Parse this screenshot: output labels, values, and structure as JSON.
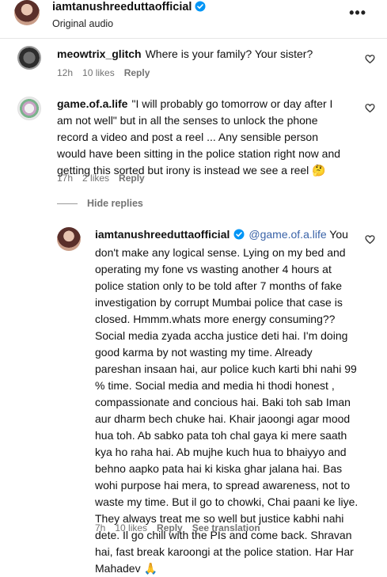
{
  "header": {
    "username": "iamtanushreeduttaofficial",
    "subtitle": "Original audio",
    "more_label": "•••"
  },
  "comments": [
    {
      "username": "meowtrix_glitch",
      "text": "Where is your family? Your sister?",
      "time": "12h",
      "likes": "10 likes",
      "reply": "Reply"
    },
    {
      "username": "game.of.a.life",
      "text": "\"I will probably go tomorrow or day after I am not well\" but in all the senses to unlock the phone record a video and post a reel ... Any sensible person would have been sitting in the police station right now and getting this sorted but irony is instead we see a reel 🤔",
      "time": "17h",
      "likes": "2 likes",
      "reply": "Reply"
    }
  ],
  "hide_replies": "Hide replies",
  "reply": {
    "username": "iamtanushreeduttaofficial",
    "mention": "@game.of.a.life",
    "text": "You don't make any logical sense. Lying on my bed and operating my fone vs wasting another 4 hours at police station only to be told after 7 months of fake investigation by corrupt Mumbai police that case is closed. Hmmm.whats more energy consuming?? Social media zyada accha justice deti hai. I'm doing good karma by not wasting my time. Already pareshan insaan hai, aur police kuch karti bhi nahi 99 % time. Social media and media hi thodi honest , compassionate and concious hai. Baki toh sab Iman aur dharm bech chuke hai. Khair jaoongi agar mood hua toh. Ab sabko pata toh chal gaya ki mere saath kya ho raha hai. Ab mujhe kuch hua to bhaiyyo and behno aapko pata hai ki kiska ghar jalana hai. Bas wohi purpose hai mera, to spread awareness, not to waste my time. But il go to chowki, Chai paani ke liye. They always treat me so well but justice kabhi nahi dete. Il go chill with the PIs and come back. Shravan hai, fast break karoongi at the police station. Har Har Mahadev 🙏",
    "time": "7h",
    "likes": "10 likes",
    "reply": "Reply",
    "translation": "See translation"
  }
}
